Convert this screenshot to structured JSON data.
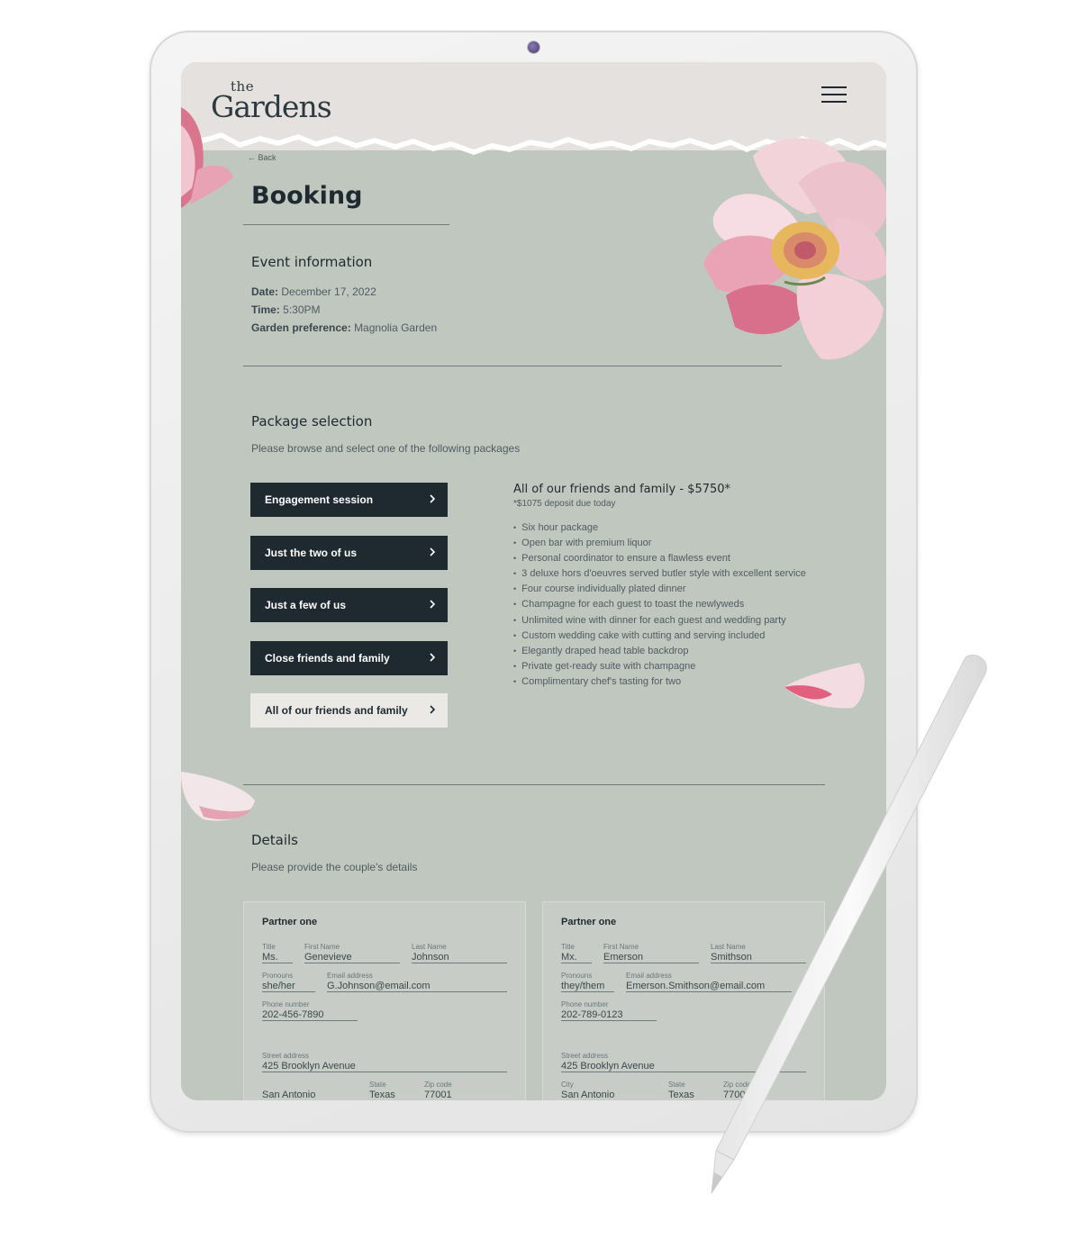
{
  "header": {
    "logo_the": "the",
    "logo_main": "Gardens",
    "back_label": "← Back",
    "page_title": "Booking"
  },
  "event": {
    "heading": "Event information",
    "date_label": "Date:",
    "date_value": "December 17, 2022",
    "time_label": "Time:",
    "time_value": "5:30PM",
    "garden_label": "Garden preference:",
    "garden_value": "Magnolia Garden"
  },
  "packages": {
    "heading": "Package selection",
    "subtitle": "Please browse and select one of the following packages",
    "options": [
      {
        "label": "Engagement session"
      },
      {
        "label": "Just the two of us"
      },
      {
        "label": "Just a few of us"
      },
      {
        "label": "Close friends and family"
      },
      {
        "label": "All of our friends and family"
      }
    ],
    "selected_index": 4,
    "detail": {
      "title": "All of our friends and family - $5750*",
      "deposit": "*$1075 deposit due today",
      "items": [
        "Six hour package",
        "Open bar with premium liquor",
        "Personal coordinator to ensure a flawless event",
        "3 deluxe hors d'oeuvres served butler style with excellent service",
        "Four course individually plated dinner",
        "Champagne for each guest to toast the newlyweds",
        "Unlimited wine with dinner for each guest and wedding party",
        "Custom wedding cake with cutting and serving included",
        "Elegantly draped head table backdrop",
        "Private get-ready suite with champagne",
        "Complimentary chef's tasting for two"
      ]
    }
  },
  "details": {
    "heading": "Details",
    "subtitle": "Please provide the couple's details",
    "labels": {
      "title": "Title",
      "first_name": "First Name",
      "last_name": "Last Name",
      "pronouns": "Pronouns",
      "email": "Email address",
      "phone": "Phone number",
      "street": "Street address",
      "city": "City",
      "state": "State",
      "zip": "Zip code"
    },
    "partners": [
      {
        "heading": "Partner one",
        "title": "Ms.",
        "first_name": "Genevieve",
        "last_name": "Johnson",
        "pronouns": "she/her",
        "email": "G.Johnson@email.com",
        "phone": "202-456-7890",
        "street": "425 Brooklyn Avenue",
        "city": "San Antonio",
        "state": "Texas",
        "zip": "77001"
      },
      {
        "heading": "Partner one",
        "title": "Mx.",
        "first_name": "Emerson",
        "last_name": "Smithson",
        "pronouns": "they/them",
        "email": "Emerson.Smithson@email.com",
        "phone": "202-789-0123",
        "street": "425 Brooklyn Avenue",
        "city": "San Antonio",
        "state": "Texas",
        "zip": "77001"
      }
    ]
  },
  "colors": {
    "background": "#c0c7bf",
    "header": "#e4e1df",
    "button_dark": "#1f2a30",
    "button_selected": "#ebe9e6",
    "flower_pink": "#e8a6b6"
  }
}
